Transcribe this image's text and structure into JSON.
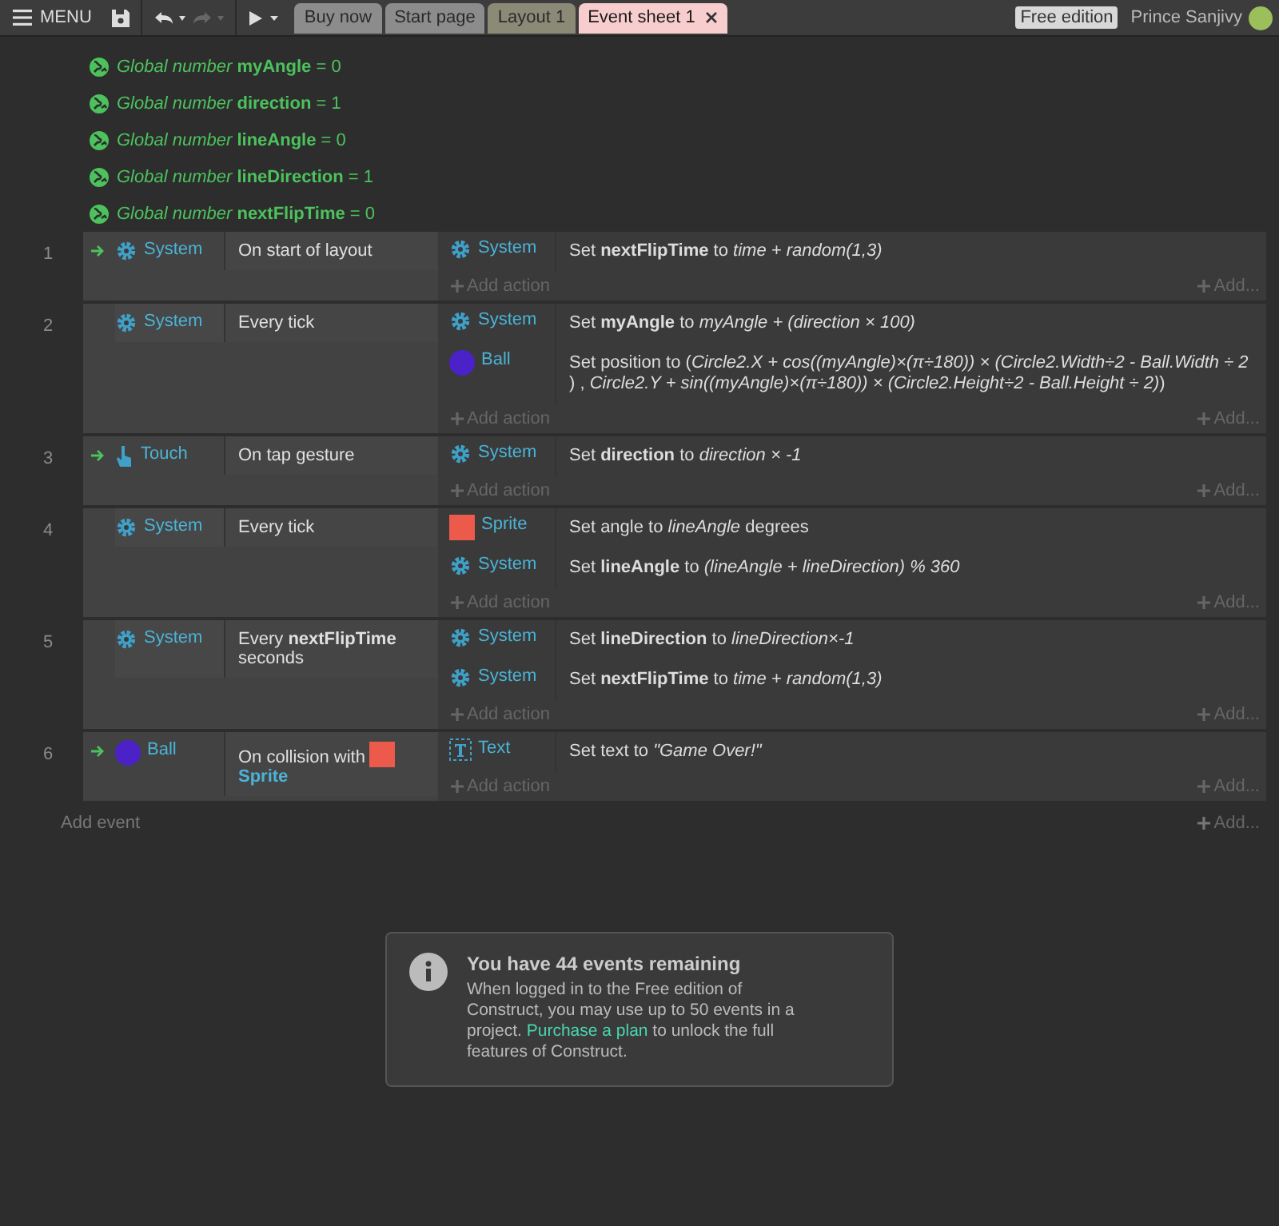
{
  "toolbar": {
    "menu": "MENU",
    "redo_disabled": true,
    "tabs": [
      {
        "label": "Buy now",
        "kind": "link",
        "selected": false
      },
      {
        "label": "Start page",
        "kind": "page",
        "selected": false
      },
      {
        "label": "Layout 1",
        "kind": "layout",
        "selected": false
      },
      {
        "label": "Event sheet 1",
        "kind": "sheet",
        "selected": true
      }
    ],
    "edition": "Free edition",
    "user": "Prince Sanjivy"
  },
  "globals": [
    {
      "text": "*Global number* **myAngle** = 0"
    },
    {
      "text": "*Global number* **direction** = 1"
    },
    {
      "text": "*Global number* **lineAngle** = 0"
    },
    {
      "text": "*Global number* **lineDirection** = 1"
    },
    {
      "text": "*Global number* **nextFlipTime** = 0"
    }
  ],
  "events": [
    {
      "number": "1",
      "trigger": true,
      "condition": {
        "object": "System",
        "kind": "gear",
        "text": "On start of layout"
      },
      "actions": [
        {
          "object": "System",
          "kind": "gear",
          "text": "Set **nextFlipTime** to  *time + random(1,3)*"
        }
      ],
      "add_action": "Add action",
      "add_more": "Add..."
    },
    {
      "number": "2",
      "trigger": false,
      "condition": {
        "object": "System",
        "kind": "gear",
        "text": "Every tick"
      },
      "actions": [
        {
          "object": "System",
          "kind": "gear",
          "text": "Set **myAngle** to *myAngle + (direction × 100)*"
        },
        {
          "object": "Ball",
          "kind": "ball",
          "text": "Set position to (*Circle2.X + cos((myAngle)×(π÷180)) × (Circle2.Width÷2 - Ball.Width ÷ 2* ) , *Circle2.Y + sin((myAngle)×(π÷180)) × (Circle2.Height÷2 - Ball.Height ÷ 2)*)"
        }
      ],
      "add_action": "Add action",
      "add_more": "Add..."
    },
    {
      "number": "3",
      "trigger": true,
      "condition": {
        "object": "Touch",
        "kind": "touch",
        "text": "On tap gesture"
      },
      "actions": [
        {
          "object": "System",
          "kind": "gear",
          "text": "Set **direction** to *direction × -1*"
        }
      ],
      "add_action": "Add action",
      "add_more": "Add..."
    },
    {
      "number": "4",
      "trigger": false,
      "condition": {
        "object": "System",
        "kind": "gear",
        "text": "Every tick"
      },
      "actions": [
        {
          "object": "Sprite",
          "kind": "sprite",
          "text": "Set angle to *lineAngle* degrees"
        },
        {
          "object": "System",
          "kind": "gear",
          "text": "Set **lineAngle** to *(lineAngle + lineDirection) % 360*"
        }
      ],
      "add_action": "Add action",
      "add_more": "Add..."
    },
    {
      "number": "5",
      "trigger": false,
      "condition": {
        "object": "System",
        "kind": "gear",
        "text": "Every **nextFlipTime** seconds"
      },
      "actions": [
        {
          "object": "System",
          "kind": "gear",
          "text": "Set **lineDirection** to *lineDirection×-1*"
        },
        {
          "object": "System",
          "kind": "gear",
          "text": "Set **nextFlipTime** to  *time + random(1,3)*"
        }
      ],
      "add_action": "Add action",
      "add_more": "Add..."
    },
    {
      "number": "6",
      "trigger": true,
      "condition": {
        "object": "Ball",
        "kind": "ball",
        "text": "On collision with",
        "param": {
          "kind": "sprite",
          "name": "Sprite"
        }
      },
      "actions": [
        {
          "object": "Text",
          "kind": "text",
          "text": "Set text to *\"Game Over!\"*"
        }
      ],
      "add_action": "Add action",
      "add_more": "Add..."
    }
  ],
  "footer": {
    "add_event": "Add event",
    "add_more": "Add..."
  },
  "notice": {
    "title": "You have 44 events remaining",
    "before": "When logged in to the Free edition of Construct, you may use up to 50 events in a project. ",
    "link": "Purchase a plan",
    "after": " to unlock the full features of Construct."
  }
}
